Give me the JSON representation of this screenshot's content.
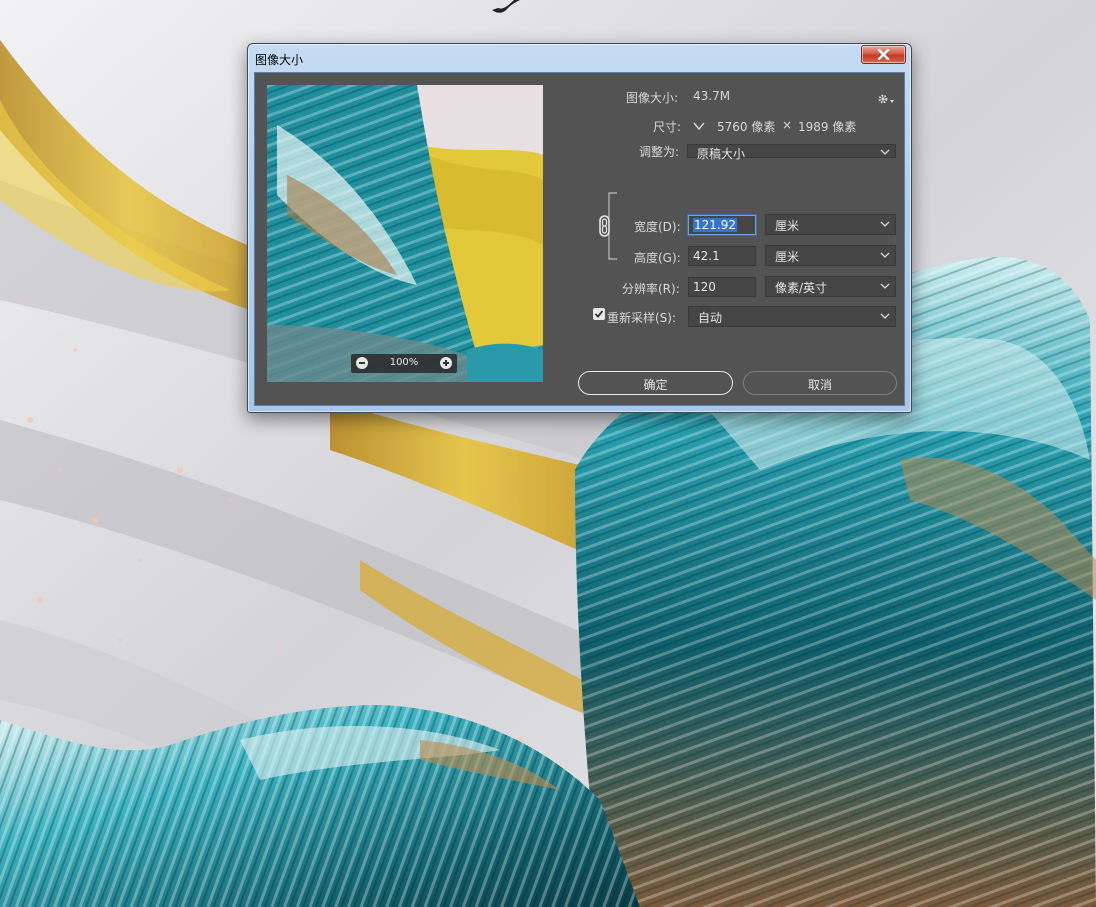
{
  "dialog": {
    "title": "图像大小",
    "image_size_label": "图像大小:",
    "image_size_value": "43.7M",
    "dimensions_label": "尺寸:",
    "dimensions_width": "5760 像素",
    "dimensions_times": "×",
    "dimensions_height": "1989 像素",
    "fit_to_label": "调整为:",
    "fit_to_value": "原稿大小",
    "width_label": "宽度(D):",
    "width_value": "121.92",
    "width_unit": "厘米",
    "height_label": "高度(G):",
    "height_value": "42.1",
    "height_unit": "厘米",
    "resolution_label": "分辨率(R):",
    "resolution_value": "120",
    "resolution_unit": "像素/英寸",
    "resample_label": "重新采样(S):",
    "resample_checked": true,
    "resample_value": "自动",
    "ok_label": "确定",
    "cancel_label": "取消",
    "zoom_value": "100%"
  },
  "colors": {
    "panel_bg": "#535353",
    "field_bg": "#454545",
    "selection": "#2f76d2",
    "teal": "#1e8a99",
    "gold": "#e6c23a"
  },
  "icons": [
    "close-icon",
    "gear-icon",
    "chevron-down-icon",
    "chain-link-icon",
    "zoom-in-icon",
    "zoom-out-icon",
    "checkmark-icon"
  ]
}
